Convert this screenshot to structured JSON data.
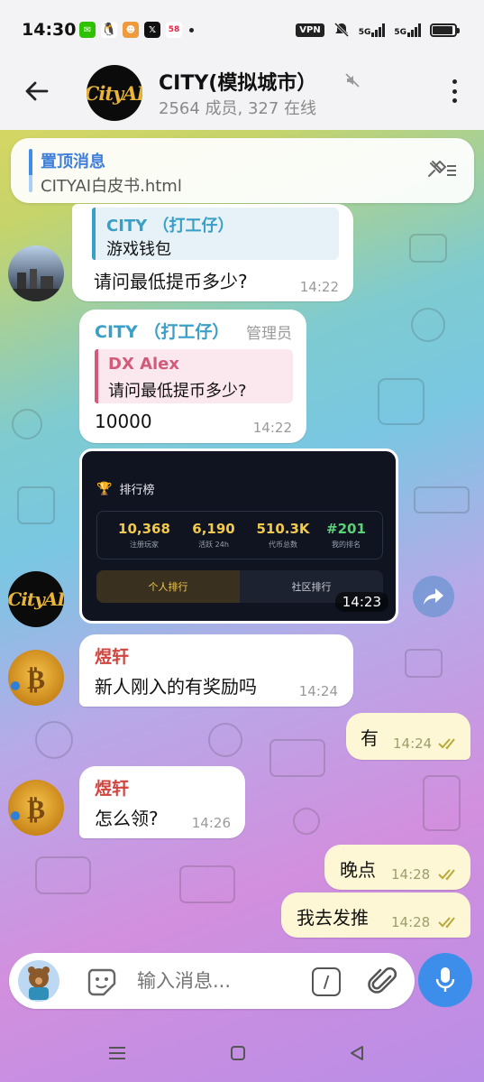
{
  "status_bar": {
    "time": "14:30",
    "apps": [
      "wechat",
      "qq",
      "game",
      "x",
      "58"
    ],
    "vpn": "VPN",
    "signal1": "5G",
    "signal2": "5G"
  },
  "header": {
    "avatar_text": "CityAI",
    "title": "CITY(模拟城市）",
    "subtitle": "2564 成员, 327 在线"
  },
  "pinned": {
    "label": "置顶消息",
    "text": "CITYAI白皮书.html"
  },
  "messages": {
    "m1": {
      "reply_name": "CITY （打工仔）",
      "reply_text": "游戏钱包",
      "text": "请问最低提币多少?",
      "time": "14:22"
    },
    "m2": {
      "sender": "CITY （打工仔）",
      "role": "管理员",
      "reply_name": "DX Alex",
      "reply_text": "请问最低提币多少?",
      "text": "10000",
      "time": "14:22"
    },
    "m3": {
      "time": "14:23"
    },
    "m4": {
      "sender": "煜轩",
      "text": "新人刚入的有奖励吗",
      "time": "14:24"
    },
    "m5": {
      "text": "有",
      "time": "14:24"
    },
    "m6": {
      "sender": "煜轩",
      "text": "怎么领?",
      "time": "14:26"
    },
    "m7": {
      "text": "晚点",
      "time": "14:28"
    },
    "m8": {
      "text": "我去发推",
      "time": "14:28"
    }
  },
  "leaderboard": {
    "title": "排行榜",
    "stats": [
      {
        "value": "10,368",
        "label": "注册玩家"
      },
      {
        "value": "6,190",
        "label": "活跃 24h"
      },
      {
        "value": "510.3K",
        "label": "代币总数"
      },
      {
        "value": "#201",
        "label": "我的排名"
      }
    ],
    "tabs": [
      "个人排行",
      "社区排行"
    ]
  },
  "sidebar_avatar_text": "CityAI",
  "input": {
    "placeholder": "输入消息..."
  },
  "colors": {
    "accent": "#3d8eea",
    "sender_blue": "#3a9fc7",
    "sender_red": "#d0453f",
    "out_bubble": "#fdf7d5"
  }
}
